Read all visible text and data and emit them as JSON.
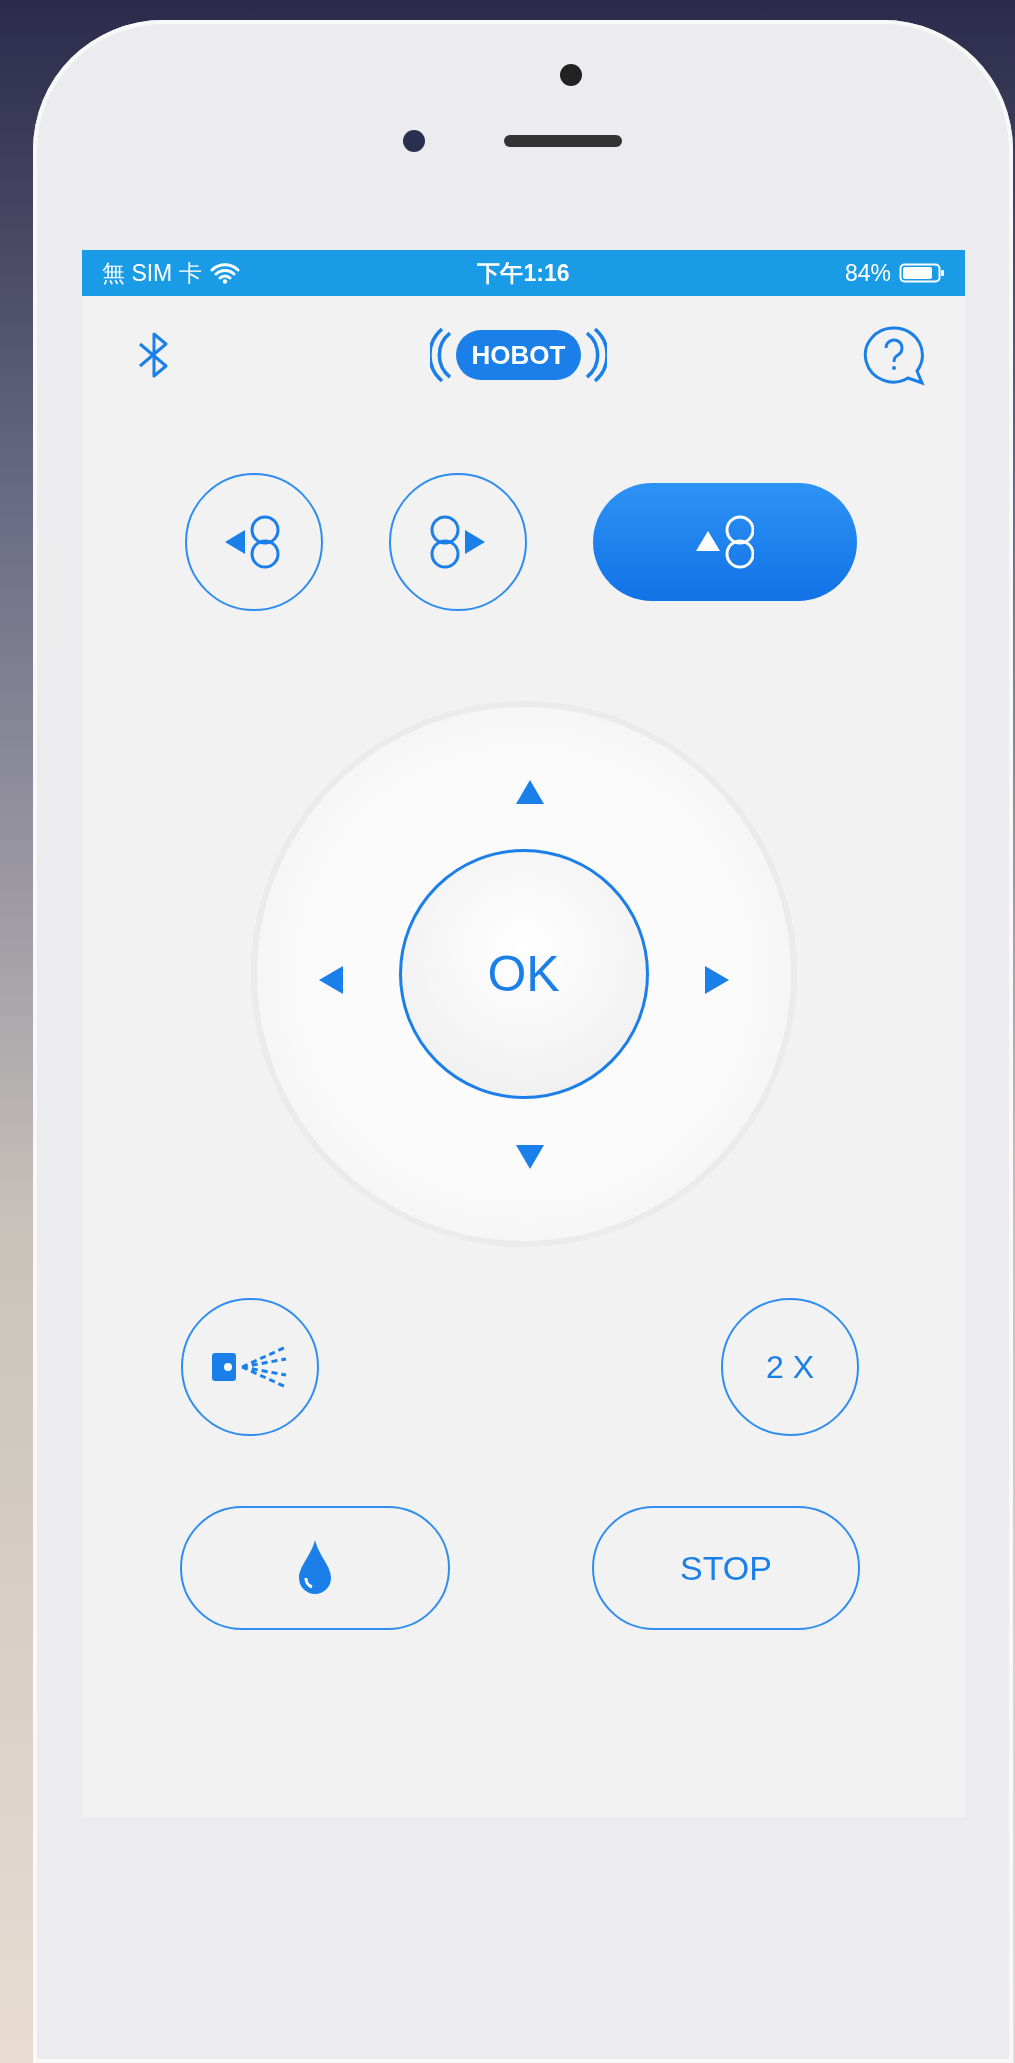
{
  "status_bar": {
    "carrier": "無 SIM 卡",
    "time": "下午1:16",
    "battery": "84%"
  },
  "header": {
    "logo": "HOBOT"
  },
  "mode_buttons": [
    {
      "kind": "left",
      "selected": false
    },
    {
      "kind": "right",
      "selected": false
    },
    {
      "kind": "up",
      "selected": true
    }
  ],
  "dpad": {
    "center": "OK"
  },
  "speed_button": "2 X",
  "stop_button": "STOP"
}
